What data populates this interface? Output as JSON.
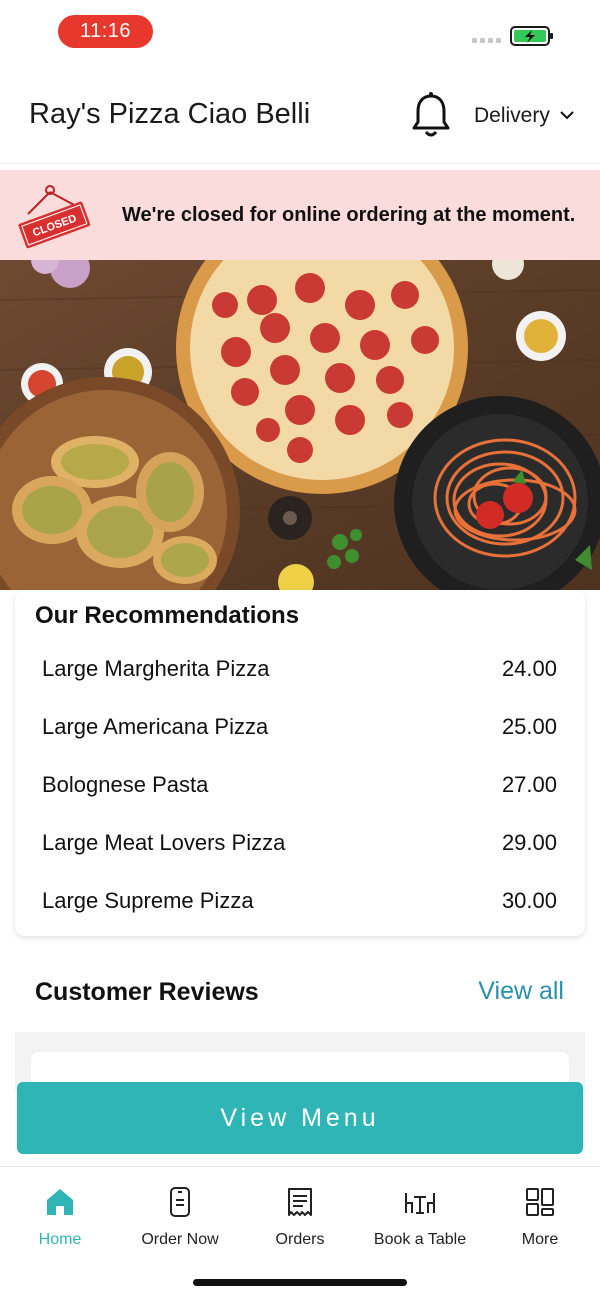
{
  "status_bar": {
    "time": "11:16"
  },
  "header": {
    "title": "Ray's Pizza Ciao Belli",
    "bell_icon": "bell-icon",
    "order_type": "Delivery"
  },
  "closed_banner": {
    "sign_text": "CLOSED",
    "message": "We're closed for online ordering at the moment."
  },
  "recommendations": {
    "title": "Our Recommendations",
    "items": [
      {
        "name": "Large Margherita Pizza",
        "price": "24.00"
      },
      {
        "name": "Large Americana Pizza",
        "price": "25.00"
      },
      {
        "name": "Bolognese Pasta",
        "price": "27.00"
      },
      {
        "name": "Large Meat Lovers Pizza",
        "price": "29.00"
      },
      {
        "name": "Large Supreme Pizza",
        "price": "30.00"
      }
    ]
  },
  "reviews": {
    "title": "Customer Reviews",
    "view_all": "View all"
  },
  "view_menu_label": "View Menu",
  "tabs": [
    {
      "label": "Home",
      "icon": "home-icon",
      "active": true
    },
    {
      "label": "Order Now",
      "icon": "order-phone-icon",
      "active": false
    },
    {
      "label": "Orders",
      "icon": "receipt-icon",
      "active": false
    },
    {
      "label": "Book a Table",
      "icon": "table-chairs-icon",
      "active": false
    },
    {
      "label": "More",
      "icon": "grid-icon",
      "active": false
    }
  ],
  "colors": {
    "accent": "#2fb5b5",
    "link": "#2a8fb0",
    "closed_banner_bg": "#fbdcdc",
    "status_time_bg": "#e8372d"
  }
}
